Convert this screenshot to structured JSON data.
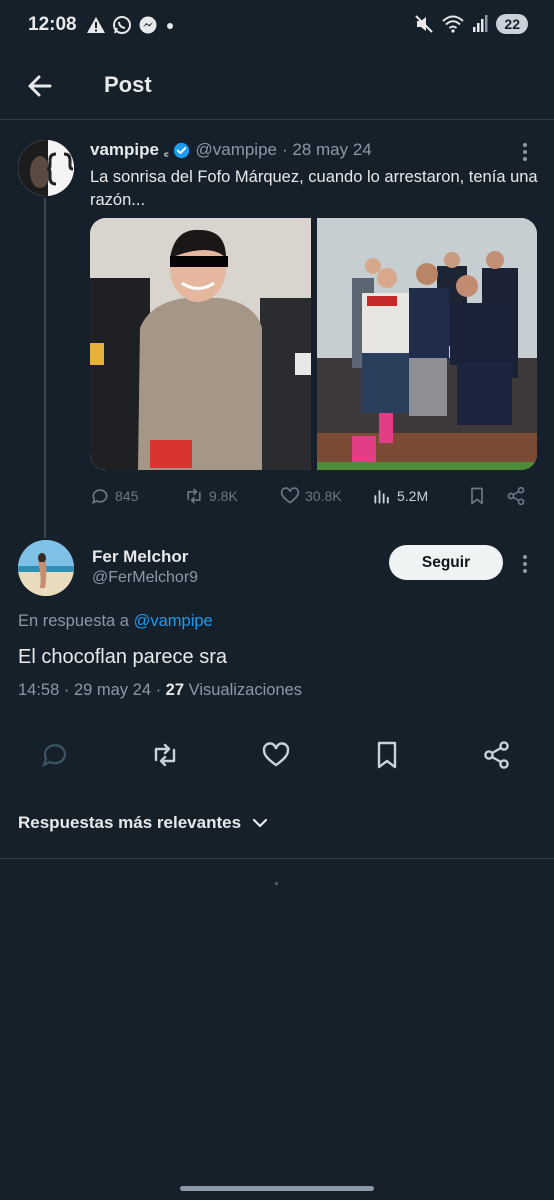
{
  "status_bar": {
    "time": "12:08",
    "battery": "22",
    "left_icons": [
      "warning-icon",
      "whatsapp-icon",
      "messenger-icon",
      "dot-icon"
    ],
    "right_icons": [
      "mute-icon",
      "wifi-icon",
      "signal-icon"
    ]
  },
  "header": {
    "title": "Post",
    "back_icon": "arrow-left-icon"
  },
  "original_tweet": {
    "display_name": "vampipe",
    "name_suffix": "꜀",
    "handle": "@vampipe",
    "date": "· 28 may 24",
    "text": "La sonrisa del Fofo Márquez, cuando lo arrestaron, tenía una razón...",
    "stats": {
      "replies": "845",
      "retweets": "9.8K",
      "likes": "30.8K",
      "views": "5.2M"
    },
    "accent_color": "#1d9bf0"
  },
  "reply": {
    "display_name": "Fer Melchor",
    "handle": "@FerMelchor9",
    "follow_label": "Seguir",
    "in_reply_prefix": "En respuesta a",
    "in_reply_handle": "@vampipe",
    "text": "El chocoflan parece sra",
    "time": "14:58 · 29 may 24 · ",
    "views_count": "27",
    "views_label": "Visualizaciones"
  },
  "sort": {
    "label": "Respuestas más relevantes"
  },
  "colors": {
    "background": "#15202b",
    "text": "#e7e9ea",
    "muted": "#8b98a5",
    "link": "#1d9bf0"
  }
}
